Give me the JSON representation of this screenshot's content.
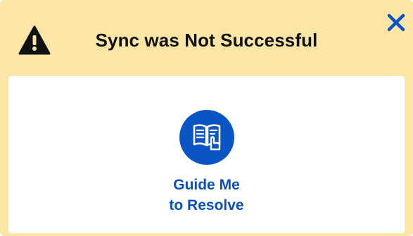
{
  "dialog": {
    "title": "Sync was Not Successful",
    "close_icon": "close-icon",
    "warning_icon": "warning-triangle-icon",
    "colors": {
      "header_bg": "#fbe6a6",
      "accent": "#0a55c6",
      "title_text": "#111111"
    }
  },
  "action": {
    "icon": "book-guide-icon",
    "label_line1": "Guide Me",
    "label_line2": "to Resolve"
  }
}
